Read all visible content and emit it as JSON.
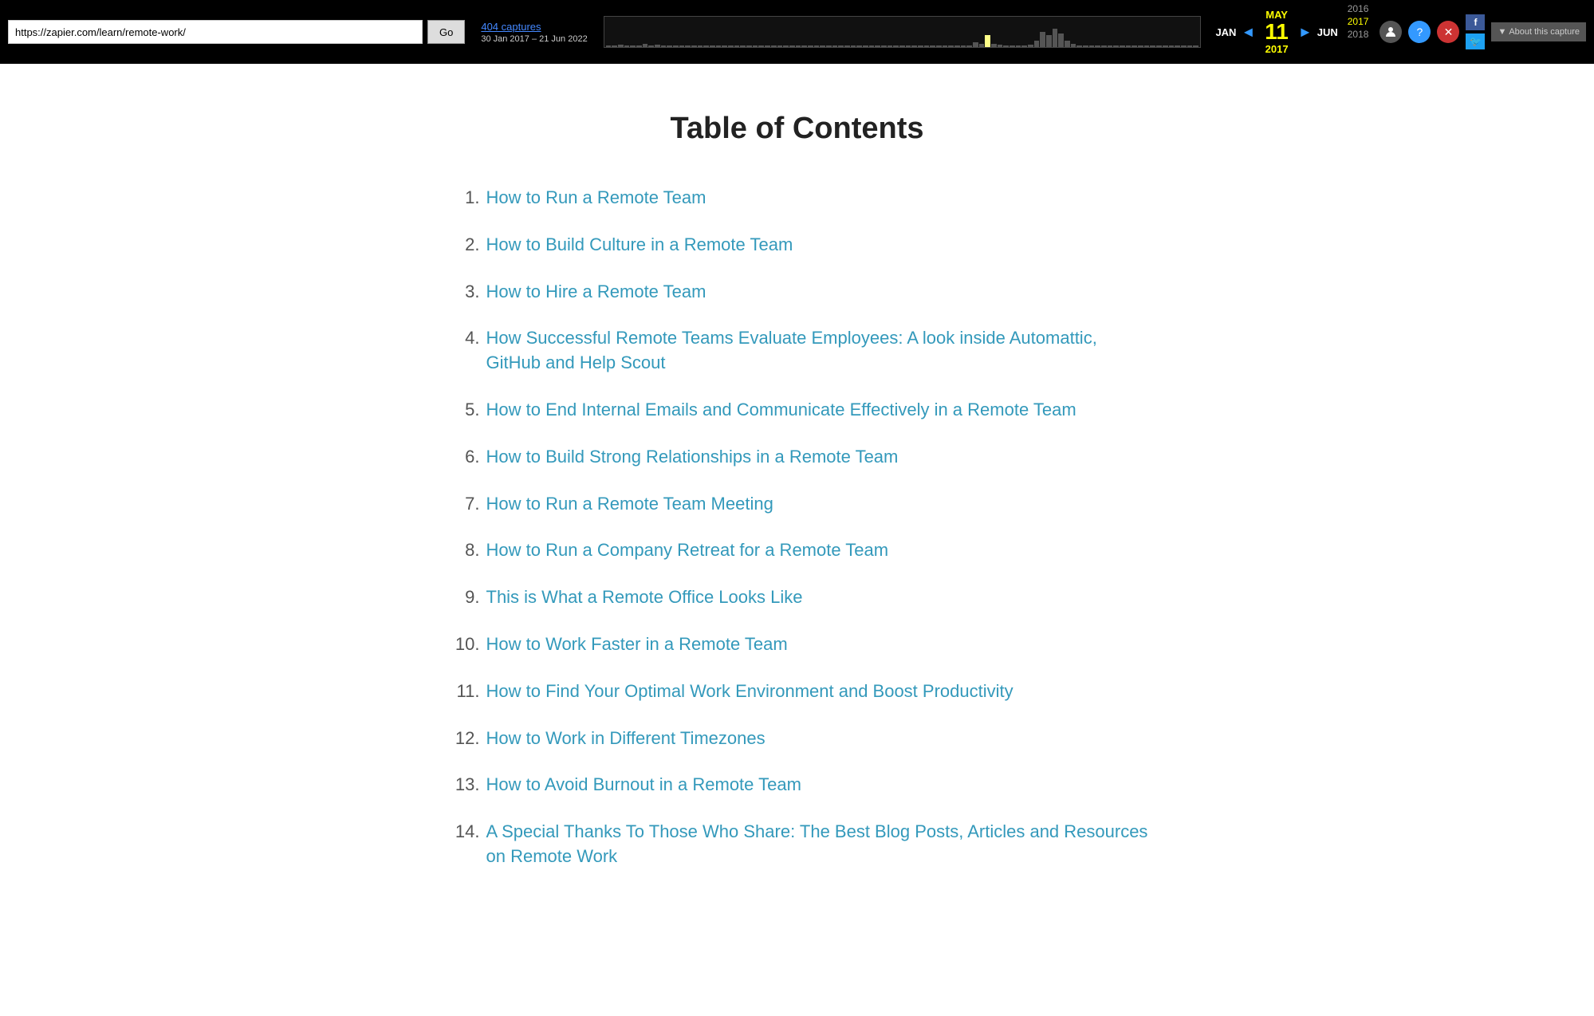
{
  "wayback": {
    "url": "https://zapier.com/learn/remote-work/",
    "go_label": "Go",
    "captures_label": "404 captures",
    "date_range": "30 Jan 2017 – 21 Jun 2022",
    "months": {
      "jan": "JAN",
      "may": "MAY",
      "jun": "JUN"
    },
    "day": "11",
    "year": "2017",
    "year_prev": "2016",
    "year_next": "2018",
    "about_label": "About this capture",
    "icons": {
      "user": "👤",
      "help": "?",
      "close": "✕",
      "facebook": "f",
      "twitter": "🐦"
    }
  },
  "page": {
    "title": "Table of Contents",
    "items": [
      {
        "number": "1.",
        "text": "How to Run a Remote Team"
      },
      {
        "number": "2.",
        "text": "How to Build Culture in a Remote Team"
      },
      {
        "number": "3.",
        "text": "How to Hire a Remote Team"
      },
      {
        "number": "4.",
        "text": "How Successful Remote Teams Evaluate Employees: A look inside Automattic, GitHub and Help Scout"
      },
      {
        "number": "5.",
        "text": "How to End Internal Emails and Communicate Effectively in a Remote Team"
      },
      {
        "number": "6.",
        "text": "How to Build Strong Relationships in a Remote Team"
      },
      {
        "number": "7.",
        "text": "How to Run a Remote Team Meeting"
      },
      {
        "number": "8.",
        "text": "How to Run a Company Retreat for a Remote Team"
      },
      {
        "number": "9.",
        "text": "This is What a Remote Office Looks Like"
      },
      {
        "number": "10.",
        "text": "How to Work Faster in a Remote Team"
      },
      {
        "number": "11.",
        "text": "How to Find Your Optimal Work Environment and Boost Productivity"
      },
      {
        "number": "12.",
        "text": "How to Work in Different Timezones"
      },
      {
        "number": "13.",
        "text": "How to Avoid Burnout in a Remote Team"
      },
      {
        "number": "14.",
        "text": "A Special Thanks To Those Who Share: The Best Blog Posts, Articles and Resources on Remote Work"
      }
    ]
  }
}
